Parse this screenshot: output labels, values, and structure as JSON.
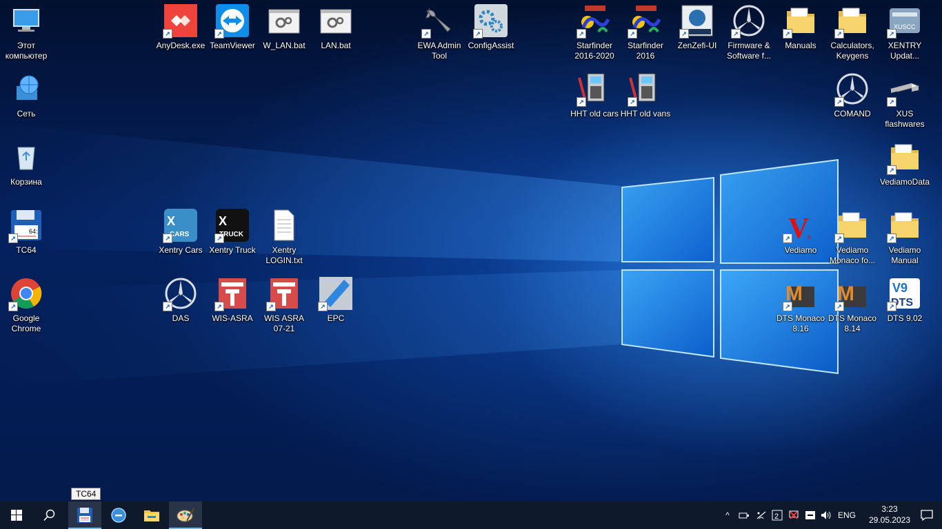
{
  "desktop": {
    "icons": [
      {
        "id": "this-pc",
        "label": "Этот компьютер",
        "icon": "computer-icon"
      },
      {
        "id": "network",
        "label": "Сеть",
        "icon": "network-globe-icon"
      },
      {
        "id": "recycle",
        "label": "Корзина",
        "icon": "recycle-bin-icon"
      },
      {
        "id": "tc64",
        "label": "TC64",
        "icon": "floppy-disk-icon"
      },
      {
        "id": "chrome",
        "label": "Google Chrome",
        "icon": "chrome-icon"
      },
      {
        "id": "anydesk",
        "label": "AnyDesk.exe",
        "icon": "anydesk-icon"
      },
      {
        "id": "teamviewer",
        "label": "TeamViewer",
        "icon": "teamviewer-icon"
      },
      {
        "id": "w_lan",
        "label": "W_LAN.bat",
        "icon": "batch-file-icon"
      },
      {
        "id": "lan",
        "label": "LAN.bat",
        "icon": "batch-file-icon"
      },
      {
        "id": "ewa",
        "label": "EWA Admin Tool",
        "icon": "wrench-icon"
      },
      {
        "id": "configassist",
        "label": "ConfigAssist",
        "icon": "gears-icon"
      },
      {
        "id": "starfinder2016_2020",
        "label": "Starfinder 2016-2020",
        "icon": "starfinder-icon"
      },
      {
        "id": "starfinder2016",
        "label": "Starfinder 2016",
        "icon": "starfinder-icon"
      },
      {
        "id": "zenzefi",
        "label": "ZenZefi-UI",
        "icon": "zenzefi-icon"
      },
      {
        "id": "firmware",
        "label": "Firmware & Software f...",
        "icon": "mercedes-star-icon"
      },
      {
        "id": "manuals",
        "label": "Manuals",
        "icon": "folder-icon"
      },
      {
        "id": "calculators",
        "label": "Calculators, Keygens",
        "icon": "folder-icon"
      },
      {
        "id": "xentry_update",
        "label": "XENTRY Updat...",
        "icon": "xentry-update-icon"
      },
      {
        "id": "hht_cars",
        "label": "HHT old cars",
        "icon": "hht-icon"
      },
      {
        "id": "hht_vans",
        "label": "HHT old vans",
        "icon": "hht-icon"
      },
      {
        "id": "comand",
        "label": "COMAND",
        "icon": "mercedes-star-icon"
      },
      {
        "id": "xus",
        "label": "XUS flashwares",
        "icon": "drive-icon"
      },
      {
        "id": "vediamodata",
        "label": "VediamoData",
        "icon": "folder-icon"
      },
      {
        "id": "xentry_cars",
        "label": "Xentry Cars",
        "icon": "xentry-cars-icon"
      },
      {
        "id": "xentry_truck",
        "label": "Xentry Truck",
        "icon": "xentry-truck-icon"
      },
      {
        "id": "xentry_login",
        "label": "Xentry LOGIN.txt",
        "icon": "text-file-icon"
      },
      {
        "id": "vediamo",
        "label": "Vediamo",
        "icon": "vediamo-icon"
      },
      {
        "id": "vediamo_monaco",
        "label": "Vediamo Monaco fo...",
        "icon": "folder-icon"
      },
      {
        "id": "vediamo_manual",
        "label": "Vediamo Manual",
        "icon": "folder-icon"
      },
      {
        "id": "das",
        "label": "DAS",
        "icon": "mercedes-star-icon"
      },
      {
        "id": "wis_asra",
        "label": "WIS-ASRA",
        "icon": "wis-lift-icon"
      },
      {
        "id": "wis_asra_0721",
        "label": "WIS ASRA 07-21",
        "icon": "wis-lift-icon"
      },
      {
        "id": "epc",
        "label": "EPC",
        "icon": "epc-icon"
      },
      {
        "id": "dts_816",
        "label": "DTS Monaco 8.16",
        "icon": "dts-monaco-icon"
      },
      {
        "id": "dts_814",
        "label": "DTS Monaco 8.14",
        "icon": "dts-monaco-icon"
      },
      {
        "id": "dts_902",
        "label": "DTS 9.02",
        "icon": "dts9-icon"
      }
    ]
  },
  "tooltip": {
    "text": "TC64"
  },
  "taskbar": {
    "start_icon": "windows-logo-icon",
    "search_icon": "search-icon",
    "pinned": [
      {
        "id": "tc64",
        "icon": "floppy-disk-icon",
        "active": true
      },
      {
        "id": "app2",
        "icon": "blue-circle-minus-icon",
        "active": false
      },
      {
        "id": "explorer",
        "icon": "file-explorer-icon",
        "active": false
      },
      {
        "id": "paint",
        "icon": "paint-palette-icon",
        "active": true
      }
    ],
    "tray": {
      "chevron": "^",
      "lang": "ENG",
      "time": "3:23",
      "date": "29.05.2023"
    }
  },
  "colors": {
    "taskbar": "#0e1a2c",
    "accent": "#76b9ed",
    "wallpaper_glow": "#3ca0ff"
  }
}
